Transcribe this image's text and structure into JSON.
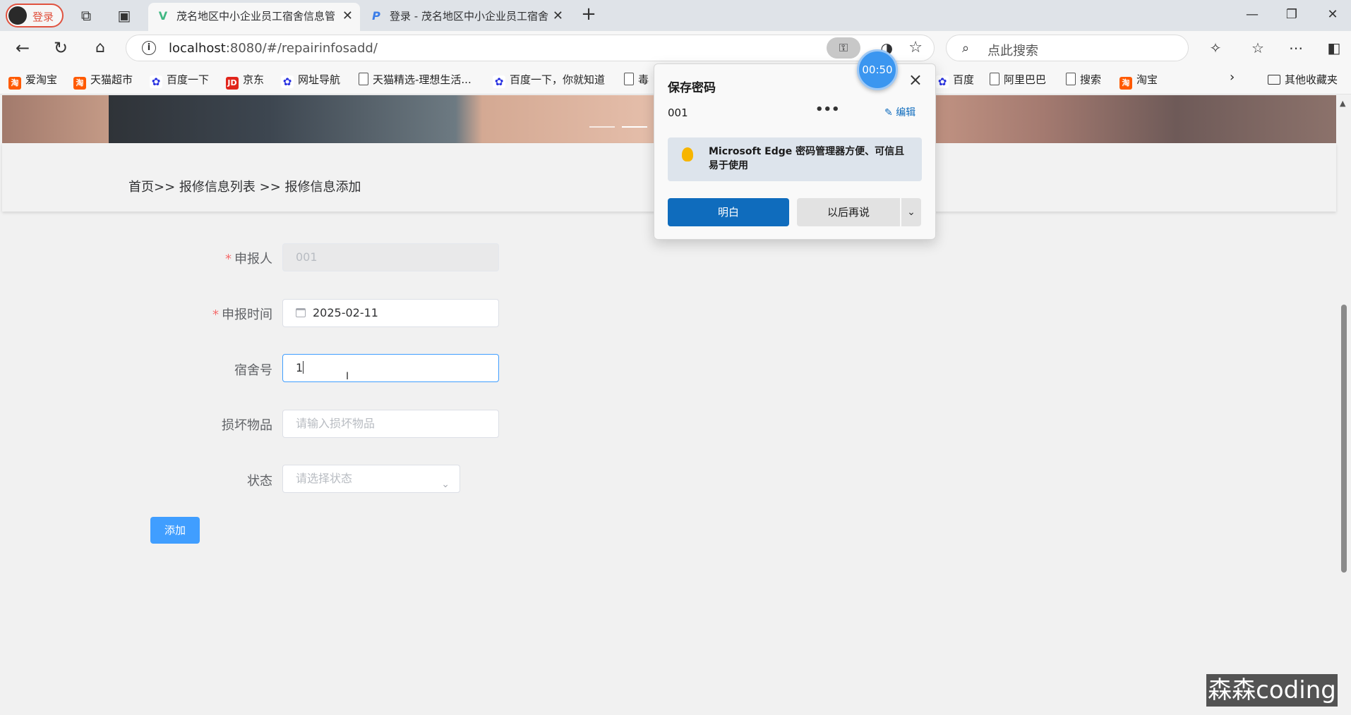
{
  "browser": {
    "profile_label": "登录",
    "tabs": [
      {
        "title": "茂名地区中小企业员工宿舍信息管",
        "favicon": "vue-icon"
      },
      {
        "title": "登录 - 茂名地区中小企业员工宿舍",
        "favicon": "p-icon"
      }
    ],
    "new_tab": "+",
    "window": {
      "minimize": "—",
      "restore": "❐",
      "close": "✕"
    },
    "address": {
      "host": "localhost",
      "path": ":8080/#/repairinfosadd/"
    },
    "search_placeholder": "点此搜索",
    "bookmarks": [
      {
        "label": "爱淘宝",
        "icon": "taobao-icon"
      },
      {
        "label": "天猫超市",
        "icon": "taobao-icon"
      },
      {
        "label": "百度一下",
        "icon": "baidu-icon"
      },
      {
        "label": "京东",
        "icon": "jd-icon"
      },
      {
        "label": "网址导航",
        "icon": "baidu-icon"
      },
      {
        "label": "天猫精选-理想生活...",
        "icon": "page-icon"
      },
      {
        "label": "百度一下，你就知道",
        "icon": "baidu-icon"
      },
      {
        "label": "毒",
        "icon": "page-icon"
      },
      {
        "label": "百度",
        "icon": "baidu-icon"
      },
      {
        "label": "阿里巴巴",
        "icon": "page-icon"
      },
      {
        "label": "搜索",
        "icon": "page-icon"
      },
      {
        "label": "淘宝",
        "icon": "taobao-icon"
      }
    ],
    "other_bookmarks": "其他收藏夹"
  },
  "page": {
    "breadcrumb": "首页>> 报修信息列表 >> 报修信息添加",
    "form": {
      "reporter": {
        "label": "申报人",
        "value": "001",
        "required": true
      },
      "report_time": {
        "label": "申报时间",
        "value": "2025-02-11",
        "required": true
      },
      "dorm_no": {
        "label": "宿舍号",
        "value": "1"
      },
      "damaged_item": {
        "label": "损坏物品",
        "placeholder": "请输入损坏物品"
      },
      "status": {
        "label": "状态",
        "placeholder": "请选择状态"
      }
    },
    "submit_label": "添加",
    "colors": {
      "primary": "#409eff",
      "required": "#f56c6c"
    }
  },
  "password_popup": {
    "title": "保存密码",
    "username": "001",
    "more": "•••",
    "edit_label": "编辑",
    "tip": "Microsoft Edge 密码管理器方便、可信且易于使用",
    "ok_label": "明白",
    "later_label": "以后再说",
    "accent": "#0f6cbd"
  },
  "timer": "00:50",
  "watermark": "森森coding"
}
